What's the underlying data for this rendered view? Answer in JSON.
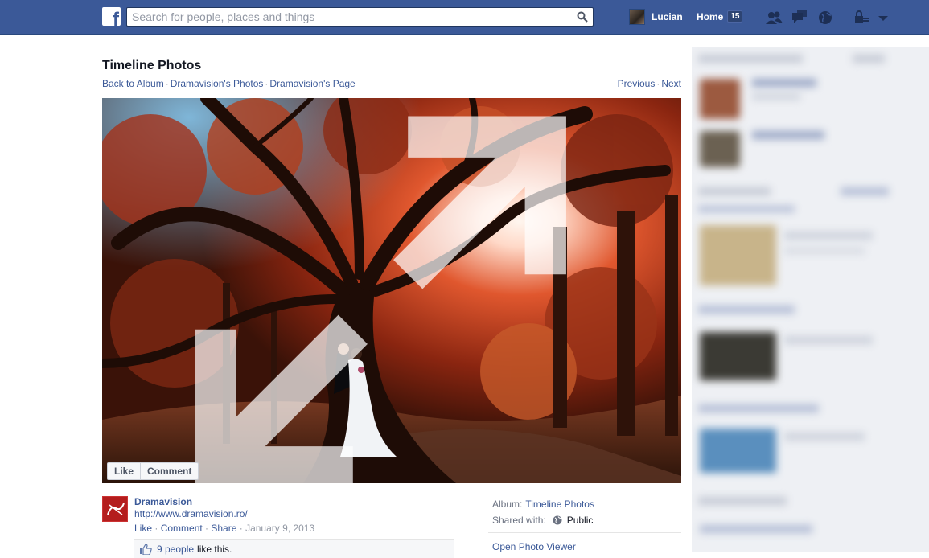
{
  "topbar": {
    "search_placeholder": "Search for people, places and things",
    "user_name": "Lucian",
    "home_label": "Home",
    "home_count": "15"
  },
  "page": {
    "title": "Timeline Photos",
    "breadcrumbs": [
      "Back to Album",
      "Dramavision's Photos",
      "Dramavision's Page"
    ],
    "previous_label": "Previous",
    "next_label": "Next"
  },
  "photo_actions": {
    "like_label": "Like",
    "comment_label": "Comment"
  },
  "post": {
    "owner_name": "Dramavision",
    "owner_url": "http://www.dramavision.ro/",
    "like_link": "Like",
    "comment_link": "Comment",
    "share_link": "Share",
    "date": "January 9, 2013",
    "likes_people": "9 people",
    "likes_suffix": "like this."
  },
  "meta": {
    "album_label": "Album:",
    "album_value": "Timeline Photos",
    "shared_label": "Shared with:",
    "shared_value": "Public",
    "open_viewer_label": "Open Photo Viewer"
  },
  "colors": {
    "brand": "#3b5998",
    "link": "#3b5998"
  }
}
